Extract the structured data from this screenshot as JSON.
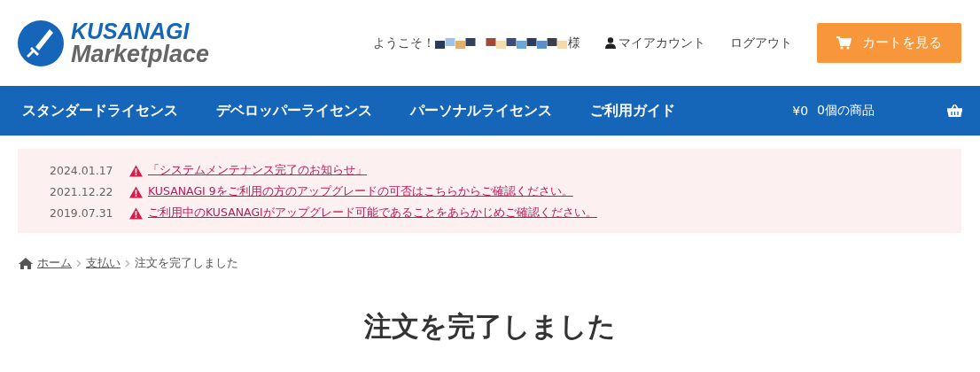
{
  "header": {
    "logo": {
      "line1": "KUSANAGI",
      "line2": "Marketplace"
    },
    "welcome": "ようこそ！",
    "honorific": "様",
    "account": "マイアカウント",
    "logout": "ログアウト",
    "cart_button": "カートを見る"
  },
  "nav": {
    "items": [
      "スタンダードライセンス",
      "デベロッパーライセンス",
      "パーソナルライセンス",
      "ご利用ガイド"
    ],
    "cart_total": "¥0",
    "cart_count": "0個の商品"
  },
  "notices": [
    {
      "date": "2024.01.17",
      "text": "「システムメンテナンス完了のお知らせ」"
    },
    {
      "date": "2021.12.22",
      "text": "KUSANAGI 9をご利用の方のアップグレードの可否はこちらからご確認ください。"
    },
    {
      "date": "2019.07.31",
      "text": "ご利用中のKUSANAGIがアップグレード可能であることをあらかじめご確認ください。"
    }
  ],
  "breadcrumb": {
    "links": [
      "ホーム",
      "支払い"
    ],
    "current": "注文を完了しました"
  },
  "page_title": "注文を完了しました"
}
